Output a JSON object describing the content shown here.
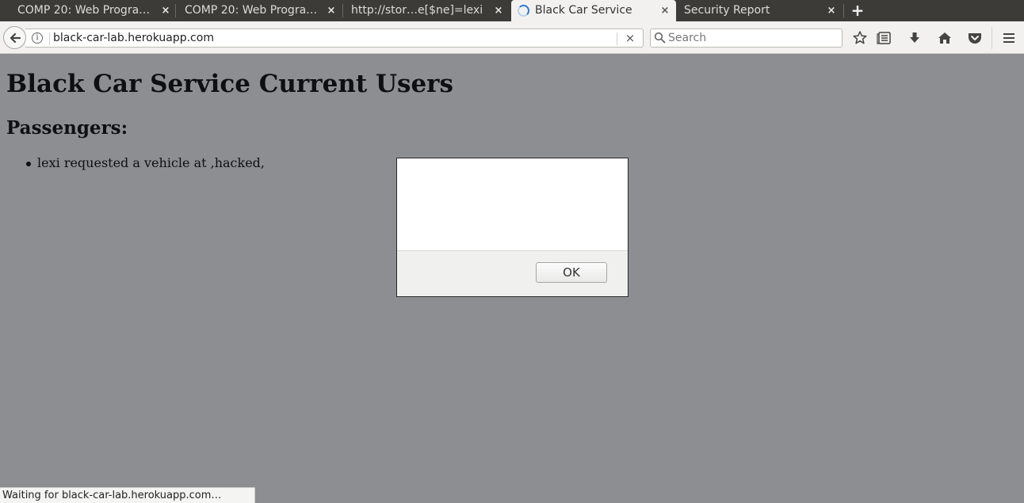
{
  "browser": {
    "tabs": [
      {
        "title": "COMP 20: Web Progra…",
        "active": false
      },
      {
        "title": "COMP 20: Web Progra…",
        "active": false
      },
      {
        "title": "http://stor…e[$ne]=lexi",
        "active": false
      },
      {
        "title": "Black Car Service",
        "active": true,
        "loading": true
      },
      {
        "title": "Security Report",
        "active": false
      }
    ],
    "tab_close_glyph": "×",
    "new_tab_glyph": "+",
    "url": "black-car-lab.herokuapp.com",
    "url_stop_glyph": "×",
    "info_glyph": "i",
    "search_placeholder": "Search",
    "toolbar_icons": [
      "bookmark-star-icon",
      "reading-list-icon",
      "downloads-icon",
      "home-icon",
      "pocket-icon",
      "menu-icon"
    ]
  },
  "page": {
    "title": "Black Car Service Current Users",
    "section_heading": "Passengers:",
    "passengers": [
      {
        "text": "lexi requested a vehicle at ,hacked,"
      }
    ]
  },
  "dialog": {
    "message": "",
    "ok_label": "OK"
  },
  "status_bar": {
    "text": "Waiting for black-car-lab.herokuapp.com…"
  },
  "colors": {
    "tab_strip": "#3c3b37",
    "active_tab": "#f2f1f0",
    "loading_spinner": "#2a7ad6"
  }
}
